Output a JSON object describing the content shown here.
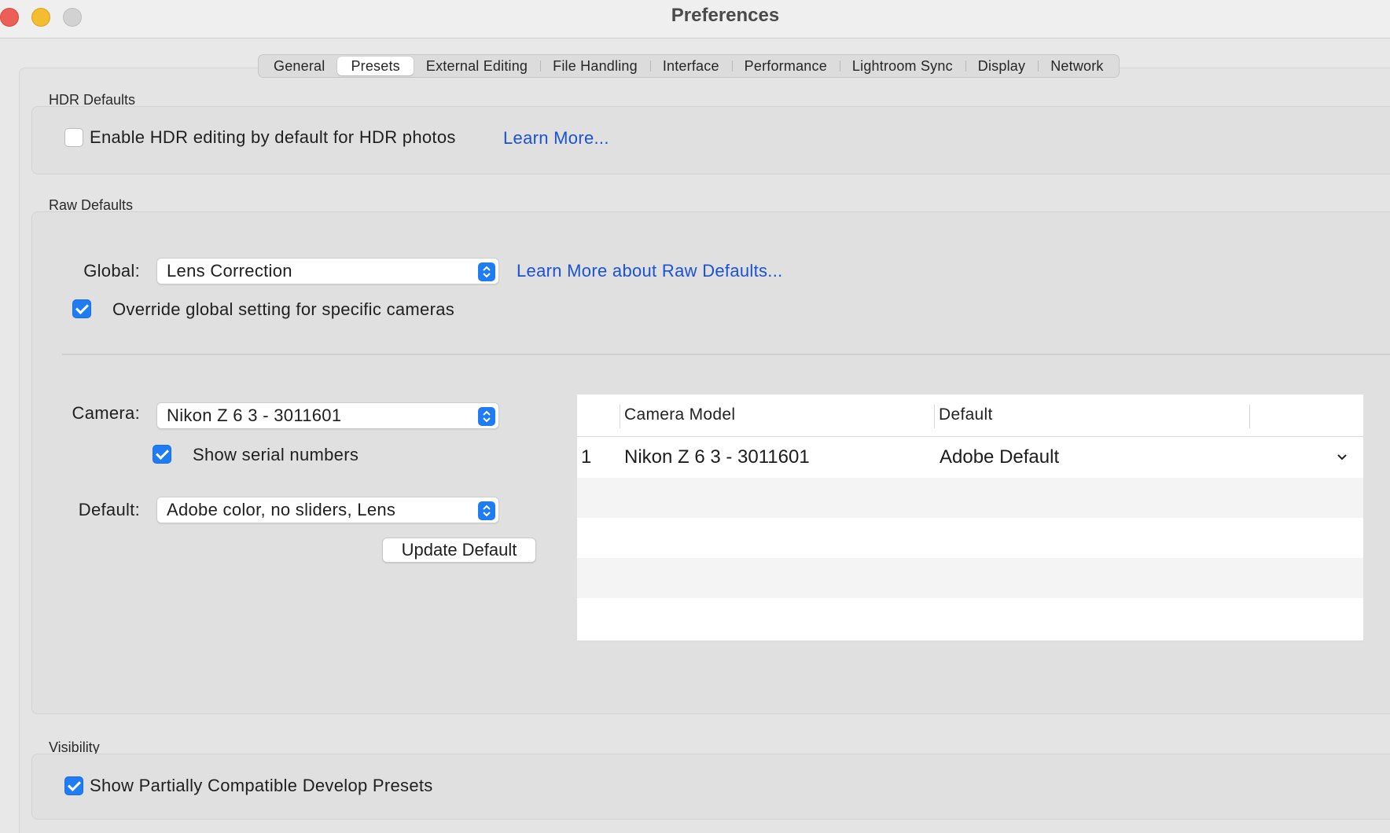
{
  "window": {
    "title": "Preferences"
  },
  "tabs": [
    {
      "label": "General"
    },
    {
      "label": "Presets"
    },
    {
      "label": "External Editing"
    },
    {
      "label": "File Handling"
    },
    {
      "label": "Interface"
    },
    {
      "label": "Performance"
    },
    {
      "label": "Lightroom Sync"
    },
    {
      "label": "Display"
    },
    {
      "label": "Network"
    }
  ],
  "active_tab": "Presets",
  "hdr": {
    "group_label": "HDR Defaults",
    "enable_label": "Enable HDR editing by default for HDR photos",
    "enable_checked": false,
    "learn_more": "Learn More..."
  },
  "raw": {
    "group_label": "Raw Defaults",
    "global_label": "Global:",
    "global_value": "Lens Correction",
    "learn_more": "Learn More about Raw Defaults...",
    "override_label": "Override global setting for specific cameras",
    "override_checked": true,
    "camera_label": "Camera:",
    "camera_value": "Nikon Z 6 3 - 3011601",
    "serial_label": "Show serial numbers",
    "serial_checked": true,
    "default_label": "Default:",
    "default_value": "Adobe color, no sliders, Lens",
    "update_button": "Update Default",
    "table": {
      "columns": [
        "",
        "Camera Model",
        "Default"
      ],
      "rows": [
        {
          "index": "1",
          "model": "Nikon Z 6 3 - 3011601",
          "default": "Adobe Default"
        }
      ]
    }
  },
  "visibility": {
    "group_label": "Visibility",
    "partial_label": "Show Partially Compatible Develop Presets",
    "partial_checked": true
  },
  "colors": {
    "accent": "#1f7cf2",
    "link": "#1a52d6"
  }
}
